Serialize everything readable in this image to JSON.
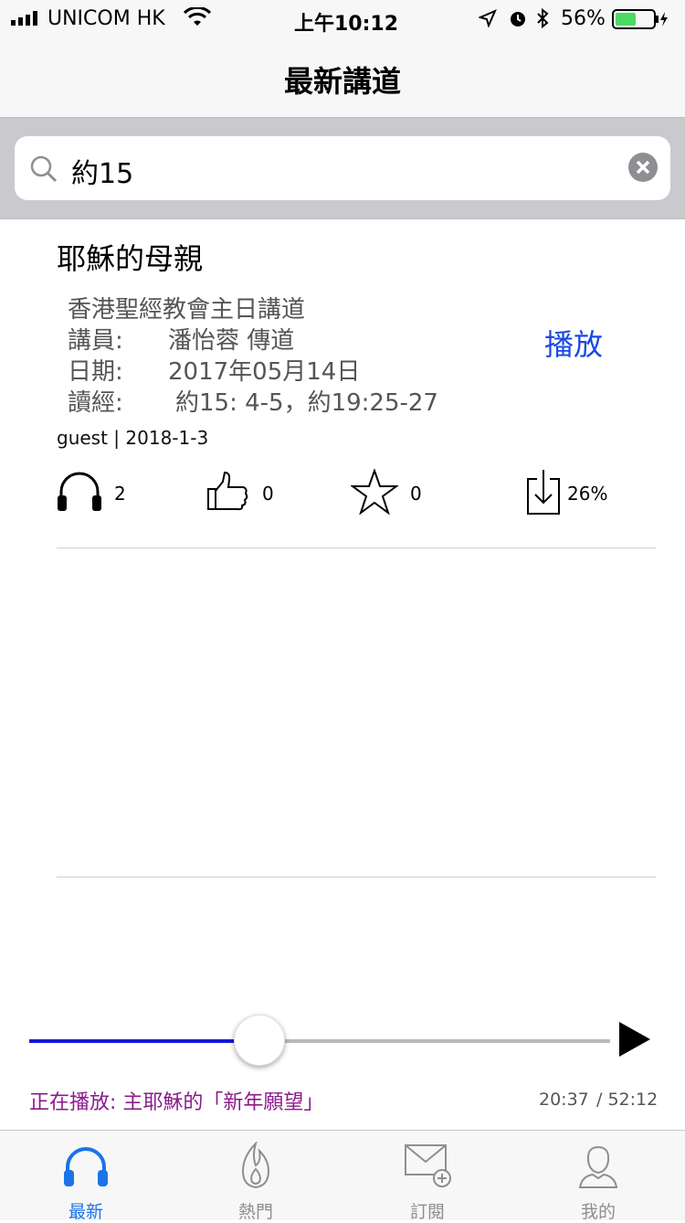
{
  "status_bar": {
    "carrier": "UNICOM HK",
    "time": "上午10:12",
    "battery_percent": "56%",
    "battery_level": 0.56,
    "battery_color": "#4cd964"
  },
  "nav": {
    "title": "最新講道"
  },
  "search": {
    "query": "約15"
  },
  "sermon": {
    "title": "耶穌的母親",
    "church": "香港聖經教會主日講道",
    "speaker_label": "講員:",
    "speaker": "潘怡蓉 傳道",
    "date_label": "日期:",
    "date": "2017年05月14日",
    "reading_label": "讀經:",
    "reading": "約15: 4-5，約19:25-27",
    "play_label": "播放",
    "meta": "guest | 2018-1-3",
    "listens": "2",
    "likes": "0",
    "favorites": "0",
    "download": "26%"
  },
  "player": {
    "now_playing": "正在播放: 主耶穌的「新年願望」",
    "current": "20:37",
    "total": "/ 52:12",
    "progress": 0.395,
    "accent": "#1515d8"
  },
  "tabs": [
    {
      "label": "最新",
      "icon": "headphones-icon",
      "active": true
    },
    {
      "label": "熱門",
      "icon": "flame-icon",
      "active": false
    },
    {
      "label": "訂閱",
      "icon": "mail-add-icon",
      "active": false
    },
    {
      "label": "我的",
      "icon": "person-icon",
      "active": false
    }
  ]
}
